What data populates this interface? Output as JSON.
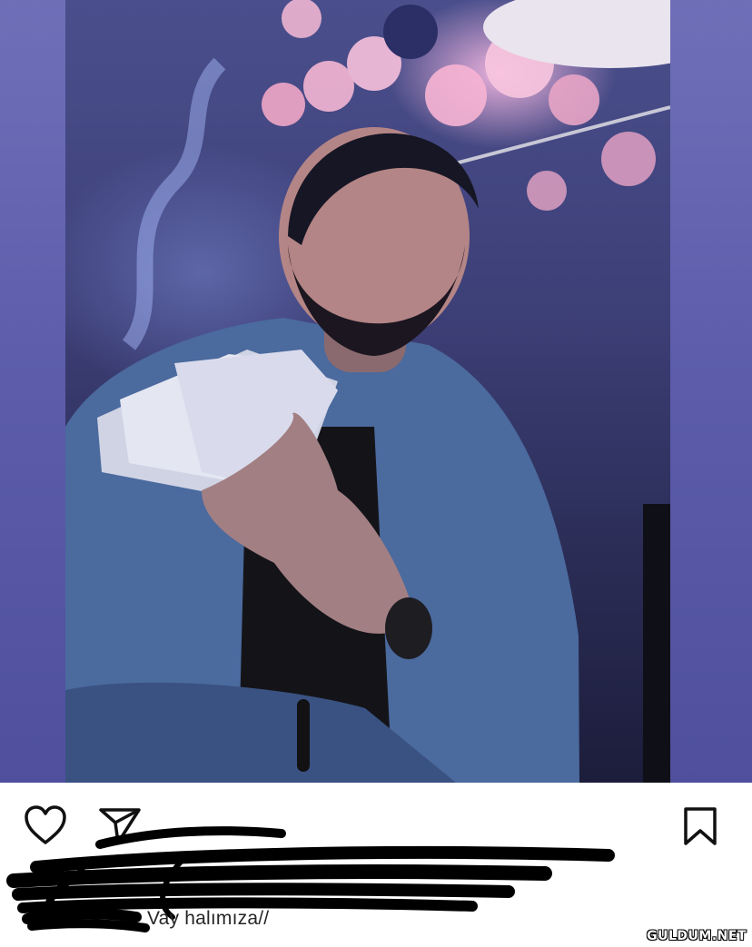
{
  "post": {
    "caption": "Vay halımıza//",
    "actions": {
      "like_icon": "heart-icon",
      "share_icon": "paper-plane-icon",
      "save_icon": "bookmark-icon"
    }
  },
  "watermark": {
    "text": "GULDUM.NET"
  },
  "colors": {
    "frame_purple": "#5d5dac",
    "caption_text": "#262626",
    "redaction": "#000000"
  }
}
